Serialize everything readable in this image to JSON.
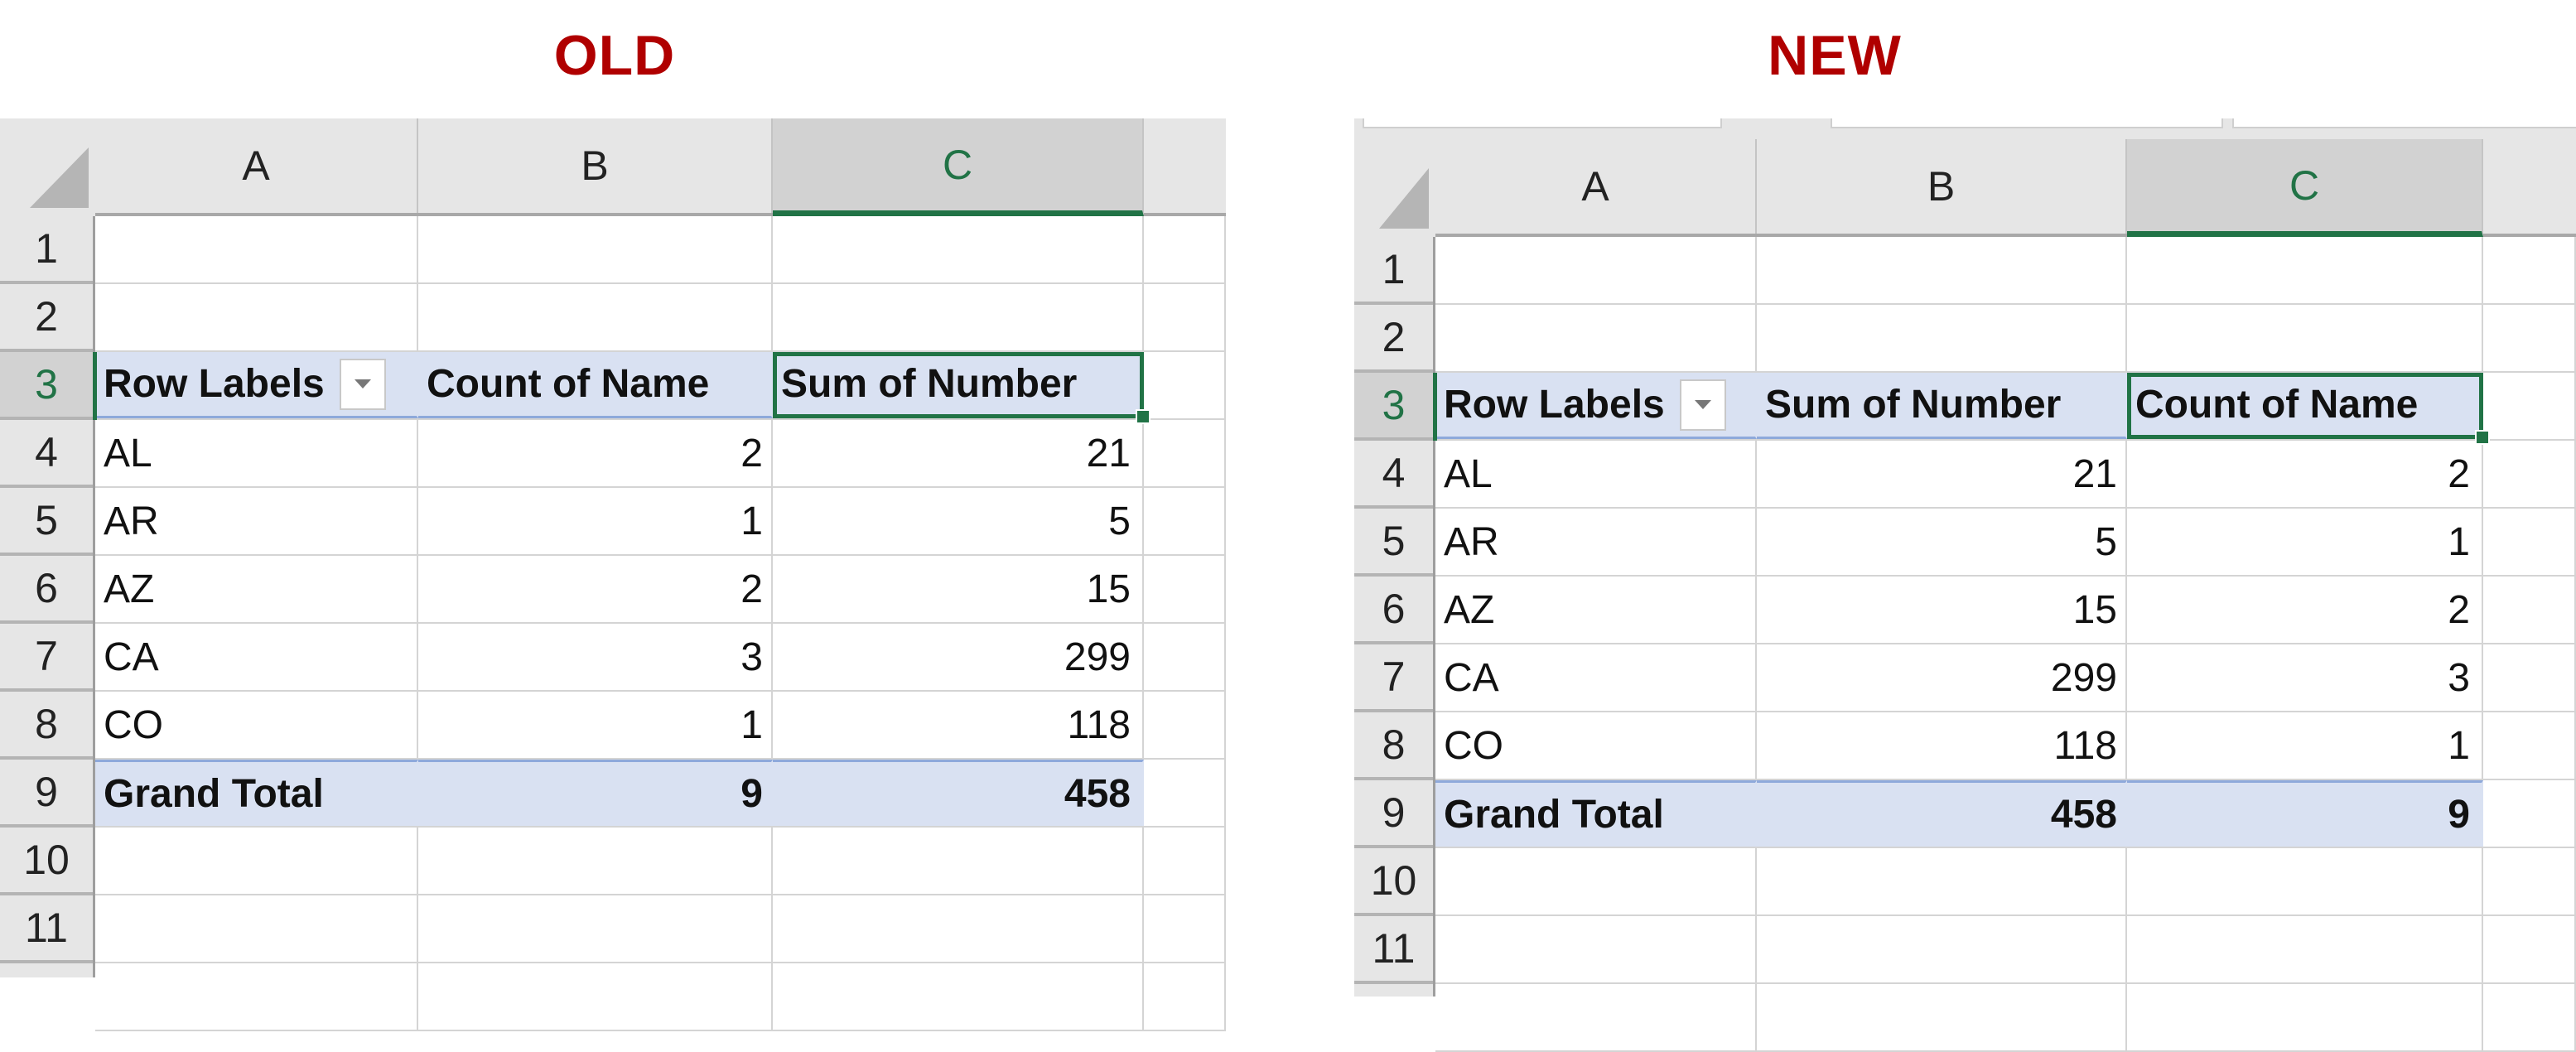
{
  "panels": {
    "old": {
      "title": "OLD",
      "columns": [
        "A",
        "B",
        "C"
      ],
      "selected_column": "C",
      "row_numbers": [
        "1",
        "2",
        "3",
        "4",
        "5",
        "6",
        "7",
        "8",
        "9",
        "10",
        "11"
      ],
      "selected_row": "3",
      "pivot": {
        "headers": [
          "Row Labels",
          "Count of Name",
          "Sum of Number"
        ],
        "rows": [
          [
            "AL",
            "2",
            "21"
          ],
          [
            "AR",
            "1",
            "5"
          ],
          [
            "AZ",
            "2",
            "15"
          ],
          [
            "CA",
            "3",
            "299"
          ],
          [
            "CO",
            "1",
            "118"
          ]
        ],
        "total": [
          "Grand Total",
          "9",
          "458"
        ]
      },
      "active_cell": "C3"
    },
    "new": {
      "title": "NEW",
      "columns": [
        "A",
        "B",
        "C"
      ],
      "selected_column": "C",
      "row_numbers": [
        "1",
        "2",
        "3",
        "4",
        "5",
        "6",
        "7",
        "8",
        "9",
        "10",
        "11"
      ],
      "selected_row": "3",
      "pivot": {
        "headers": [
          "Row Labels",
          "Sum of Number",
          "Count of Name"
        ],
        "rows": [
          [
            "AL",
            "21",
            "2"
          ],
          [
            "AR",
            "5",
            "1"
          ],
          [
            "AZ",
            "15",
            "2"
          ],
          [
            "CA",
            "299",
            "3"
          ],
          [
            "CO",
            "118",
            "1"
          ]
        ],
        "total": [
          "Grand Total",
          "458",
          "9"
        ]
      },
      "active_cell": "C3"
    }
  },
  "colors": {
    "title": "#b00000",
    "selection": "#217346",
    "pivot_fill": "#d9e1f2",
    "pivot_line": "#8ea9db"
  },
  "icons": {
    "filter_dropdown": "chevron-down-icon",
    "select_all": "select-all-triangle-icon"
  }
}
